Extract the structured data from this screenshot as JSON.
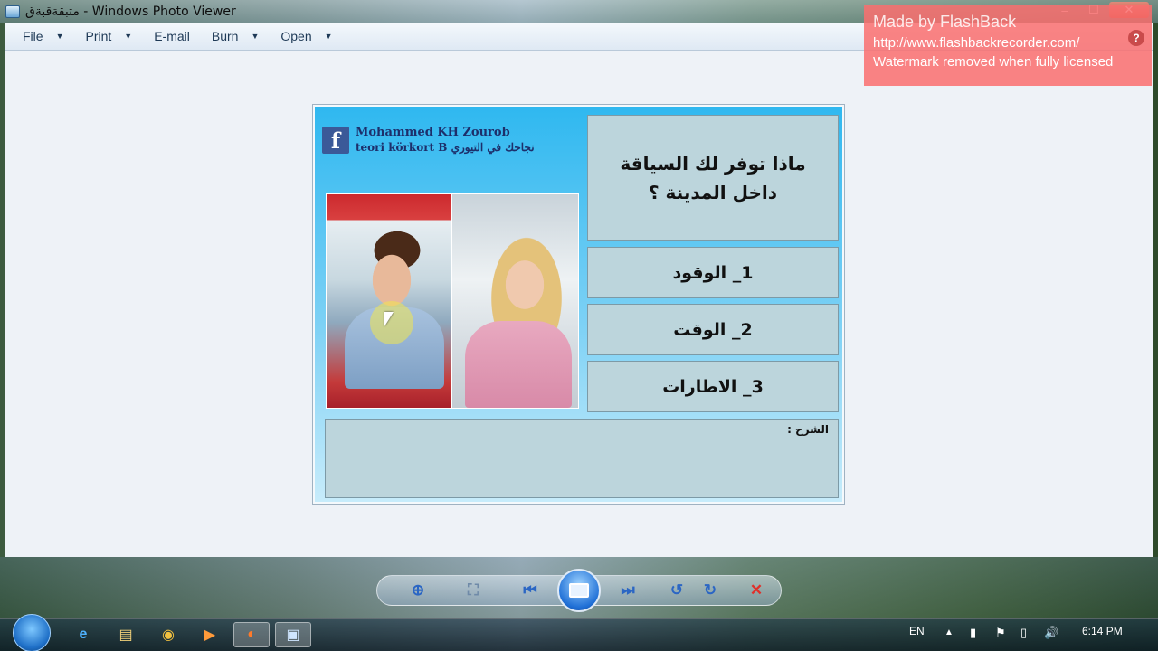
{
  "window": {
    "title": "متبقةقبةق - Windows Photo Viewer",
    "controls": {
      "minimize": "–",
      "maximize": "☐",
      "close": "✕"
    }
  },
  "menu": {
    "file": "File",
    "print": "Print",
    "email": "E-mail",
    "burn": "Burn",
    "open": "Open",
    "arrow": "▼"
  },
  "watermark": {
    "title": "Made by FlashBack",
    "url": "http://www.flashbackrecorder.com/",
    "note": "Watermark removed when fully licensed",
    "help": "?"
  },
  "quiz": {
    "facebook_glyph": "f",
    "brand_name": "Mohammed KH Zourob",
    "brand_sub": "teori körkort B نجاحك في التيوري",
    "question": "ماذا توفر لك السياقة داخل المدينة ؟",
    "answers": [
      "1_ الوقود",
      "2_ الوقت",
      "3_ الاطارات"
    ],
    "explanation_label": "الشرح :"
  },
  "viewer_controls": {
    "zoom": "⊕",
    "fit": "⛶",
    "previous": "⏮",
    "next": "⏭",
    "rotate_ccw": "↺",
    "rotate_cw": "↻",
    "delete": "✕"
  },
  "taskbar": {
    "language": "EN",
    "time": "6:14 PM",
    "icons": {
      "ie": "e",
      "explorer": "▤",
      "chrome": "◉",
      "media": "▶",
      "firefox": "◐",
      "photo_viewer": "▣"
    },
    "tray": {
      "show_hidden": "▲",
      "signal": "▮",
      "flag": "⚑",
      "battery": "▯",
      "volume": "🔊"
    }
  }
}
